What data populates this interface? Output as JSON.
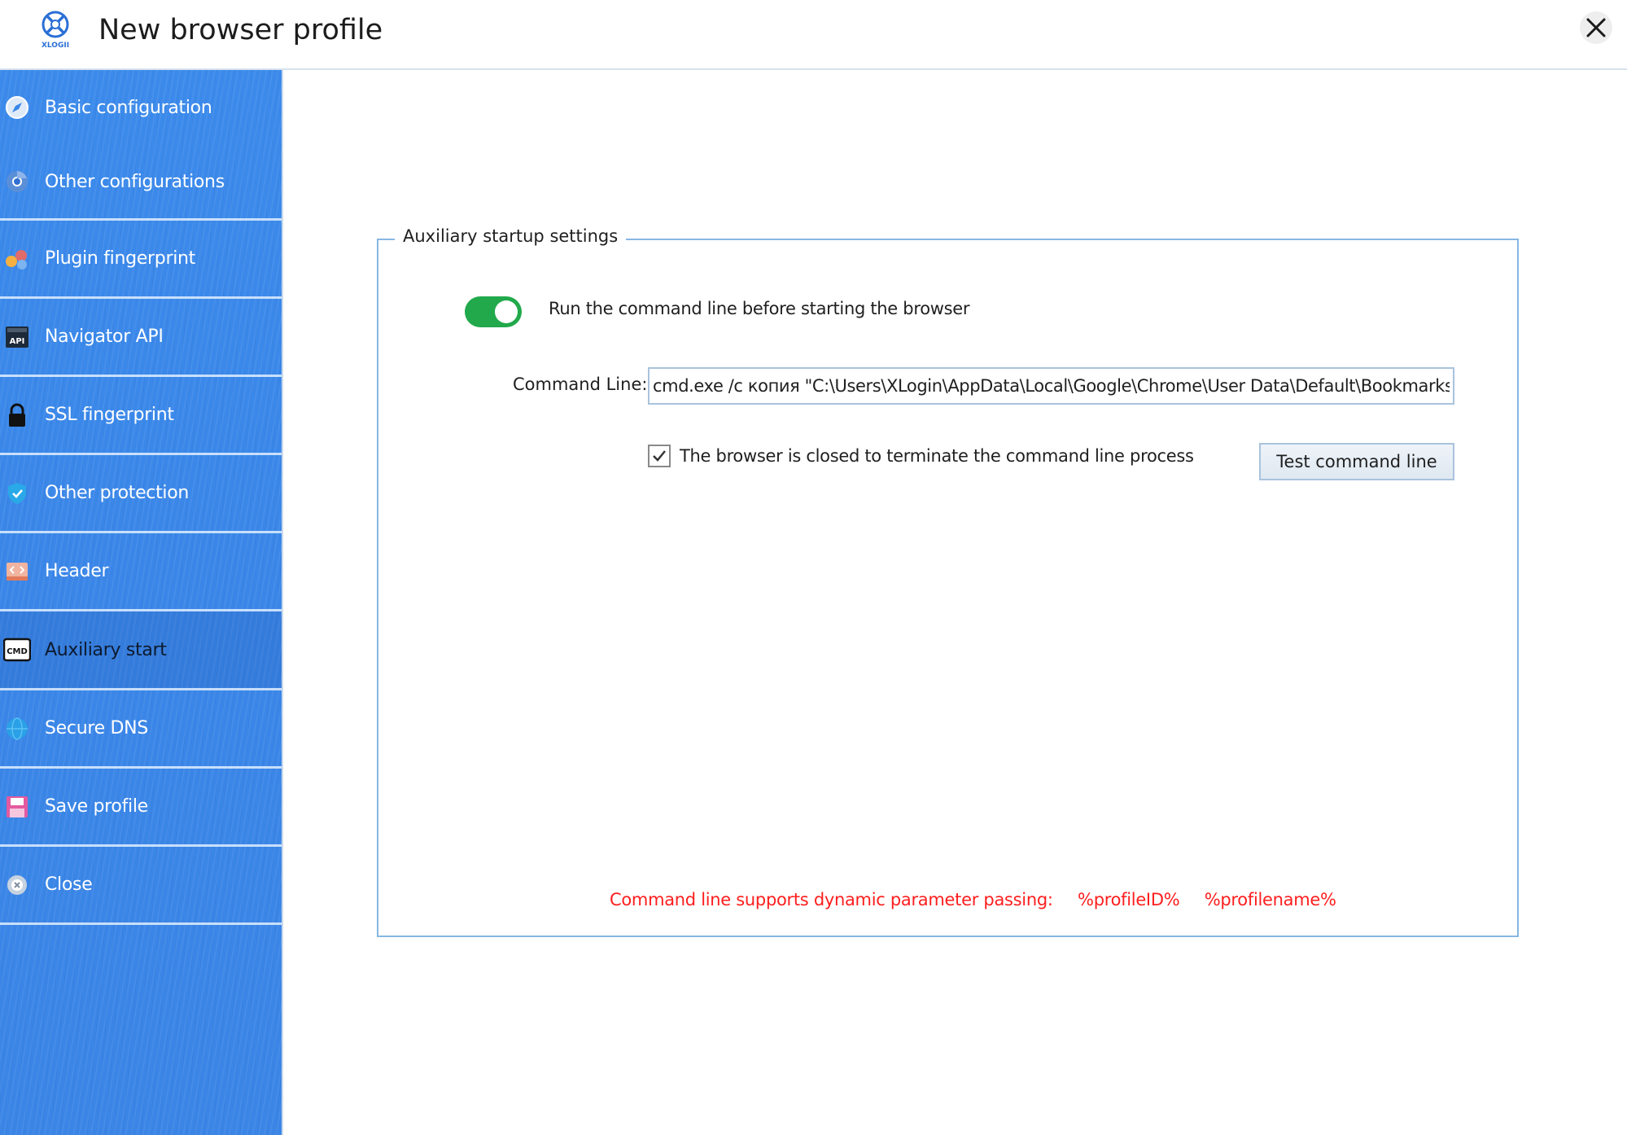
{
  "window": {
    "title": "New browser profile",
    "logo_text": "XLOGII"
  },
  "sidebar": {
    "items": [
      {
        "label": "Basic configuration",
        "icon": "compass-icon"
      },
      {
        "label": "Other configurations",
        "icon": "chrome-icon"
      },
      {
        "label": "Plugin fingerprint",
        "icon": "puzzle-icon"
      },
      {
        "label": "Navigator API",
        "icon": "api-icon"
      },
      {
        "label": "SSL fingerprint",
        "icon": "lock-icon"
      },
      {
        "label": "Other protection",
        "icon": "shield-icon"
      },
      {
        "label": "Header",
        "icon": "code-icon"
      },
      {
        "label": "Auxiliary start",
        "icon": "cmd-icon",
        "active": true
      },
      {
        "label": "Secure DNS",
        "icon": "globe-icon"
      },
      {
        "label": "Save profile",
        "icon": "save-icon"
      },
      {
        "label": "Close",
        "icon": "close-circle-icon"
      }
    ],
    "icon_badges": {
      "api": "API",
      "cmd": "CMD"
    }
  },
  "auxiliary": {
    "group_title": "Auxiliary startup settings",
    "toggle_label": "Run the command line before starting the browser",
    "toggle_on": true,
    "command_line_label": "Command Line:",
    "command_line_value": "cmd.exe /c копия \"C:\\Users\\XLogin\\AppData\\Local\\Google\\Chrome\\User Data\\Default\\Bookmarks\" \"D",
    "terminate_checkbox_label": "The browser is closed to terminate the command line process",
    "terminate_checked": true,
    "test_button_label": "Test command line",
    "hint_text": "Command line supports dynamic parameter passing:",
    "hint_params": [
      "%profileID%",
      "%profilename%"
    ]
  },
  "colors": {
    "sidebar_blue": "#3a87e8",
    "toggle_green": "#21a94b",
    "hint_red": "#ff1e1e",
    "group_border": "#86b7e3"
  }
}
